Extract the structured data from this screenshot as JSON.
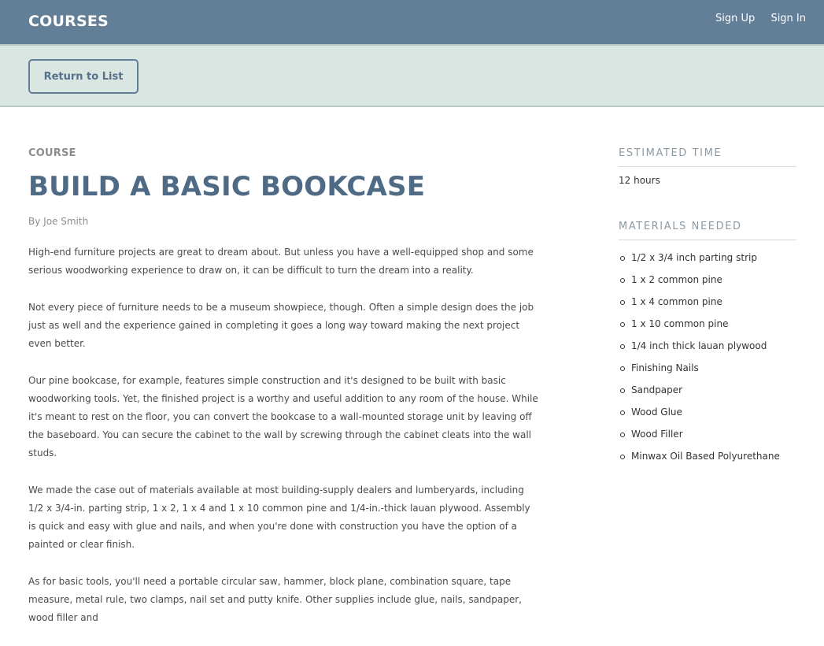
{
  "header": {
    "brand": "COURSES",
    "nav": {
      "sign_up": "Sign Up",
      "sign_in": "Sign In"
    }
  },
  "toolbar": {
    "return_label": "Return to List"
  },
  "course": {
    "eyebrow": "COURSE",
    "title": "BUILD A BASIC BOOKCASE",
    "author": "By Joe Smith",
    "paragraphs": [
      "High-end furniture projects are great to dream about. But unless you have a well-equipped shop and some serious woodworking experience to draw on, it can be difficult to turn the dream into a reality.",
      "Not every piece of furniture needs to be a museum showpiece, though. Often a simple design does the job just as well and the experience gained in completing it goes a long way toward making the next project even better.",
      "Our pine bookcase, for example, features simple construction and it's designed to be built with basic woodworking tools. Yet, the finished project is a worthy and useful addition to any room of the house. While it's meant to rest on the floor, you can convert the bookcase to a wall-mounted storage unit by leaving off the baseboard. You can secure the cabinet to the wall by screwing through the cabinet cleats into the wall studs.",
      "We made the case out of materials available at most building-supply dealers and lumberyards, including 1/2 x 3/4-in. parting strip, 1 x 2, 1 x 4 and 1 x 10 common pine and 1/4-in.-thick lauan plywood. Assembly is quick and easy with glue and nails, and when you're done with construction you have the option of a painted or clear finish.",
      "As for basic tools, you'll need a portable circular saw, hammer, block plane, combination square, tape measure, metal rule, two clamps, nail set and putty knife. Other supplies include glue, nails, sandpaper, wood filler and"
    ]
  },
  "sidebar": {
    "time_heading": "ESTIMATED TIME",
    "time_value": "12 hours",
    "materials_heading": "MATERIALS NEEDED",
    "materials": [
      "1/2 x 3/4 inch parting strip",
      "1 x 2 common pine",
      "1 x 4 common pine",
      "1 x 10 common pine",
      "1/4 inch thick lauan plywood",
      "Finishing Nails",
      "Sandpaper",
      "Wood Glue",
      "Wood Filler",
      "Minwax Oil Based Polyurethane"
    ]
  },
  "colors": {
    "header_bg": "#637e97",
    "subbar_bg": "#dae6e1",
    "title": "#4f6a84"
  }
}
